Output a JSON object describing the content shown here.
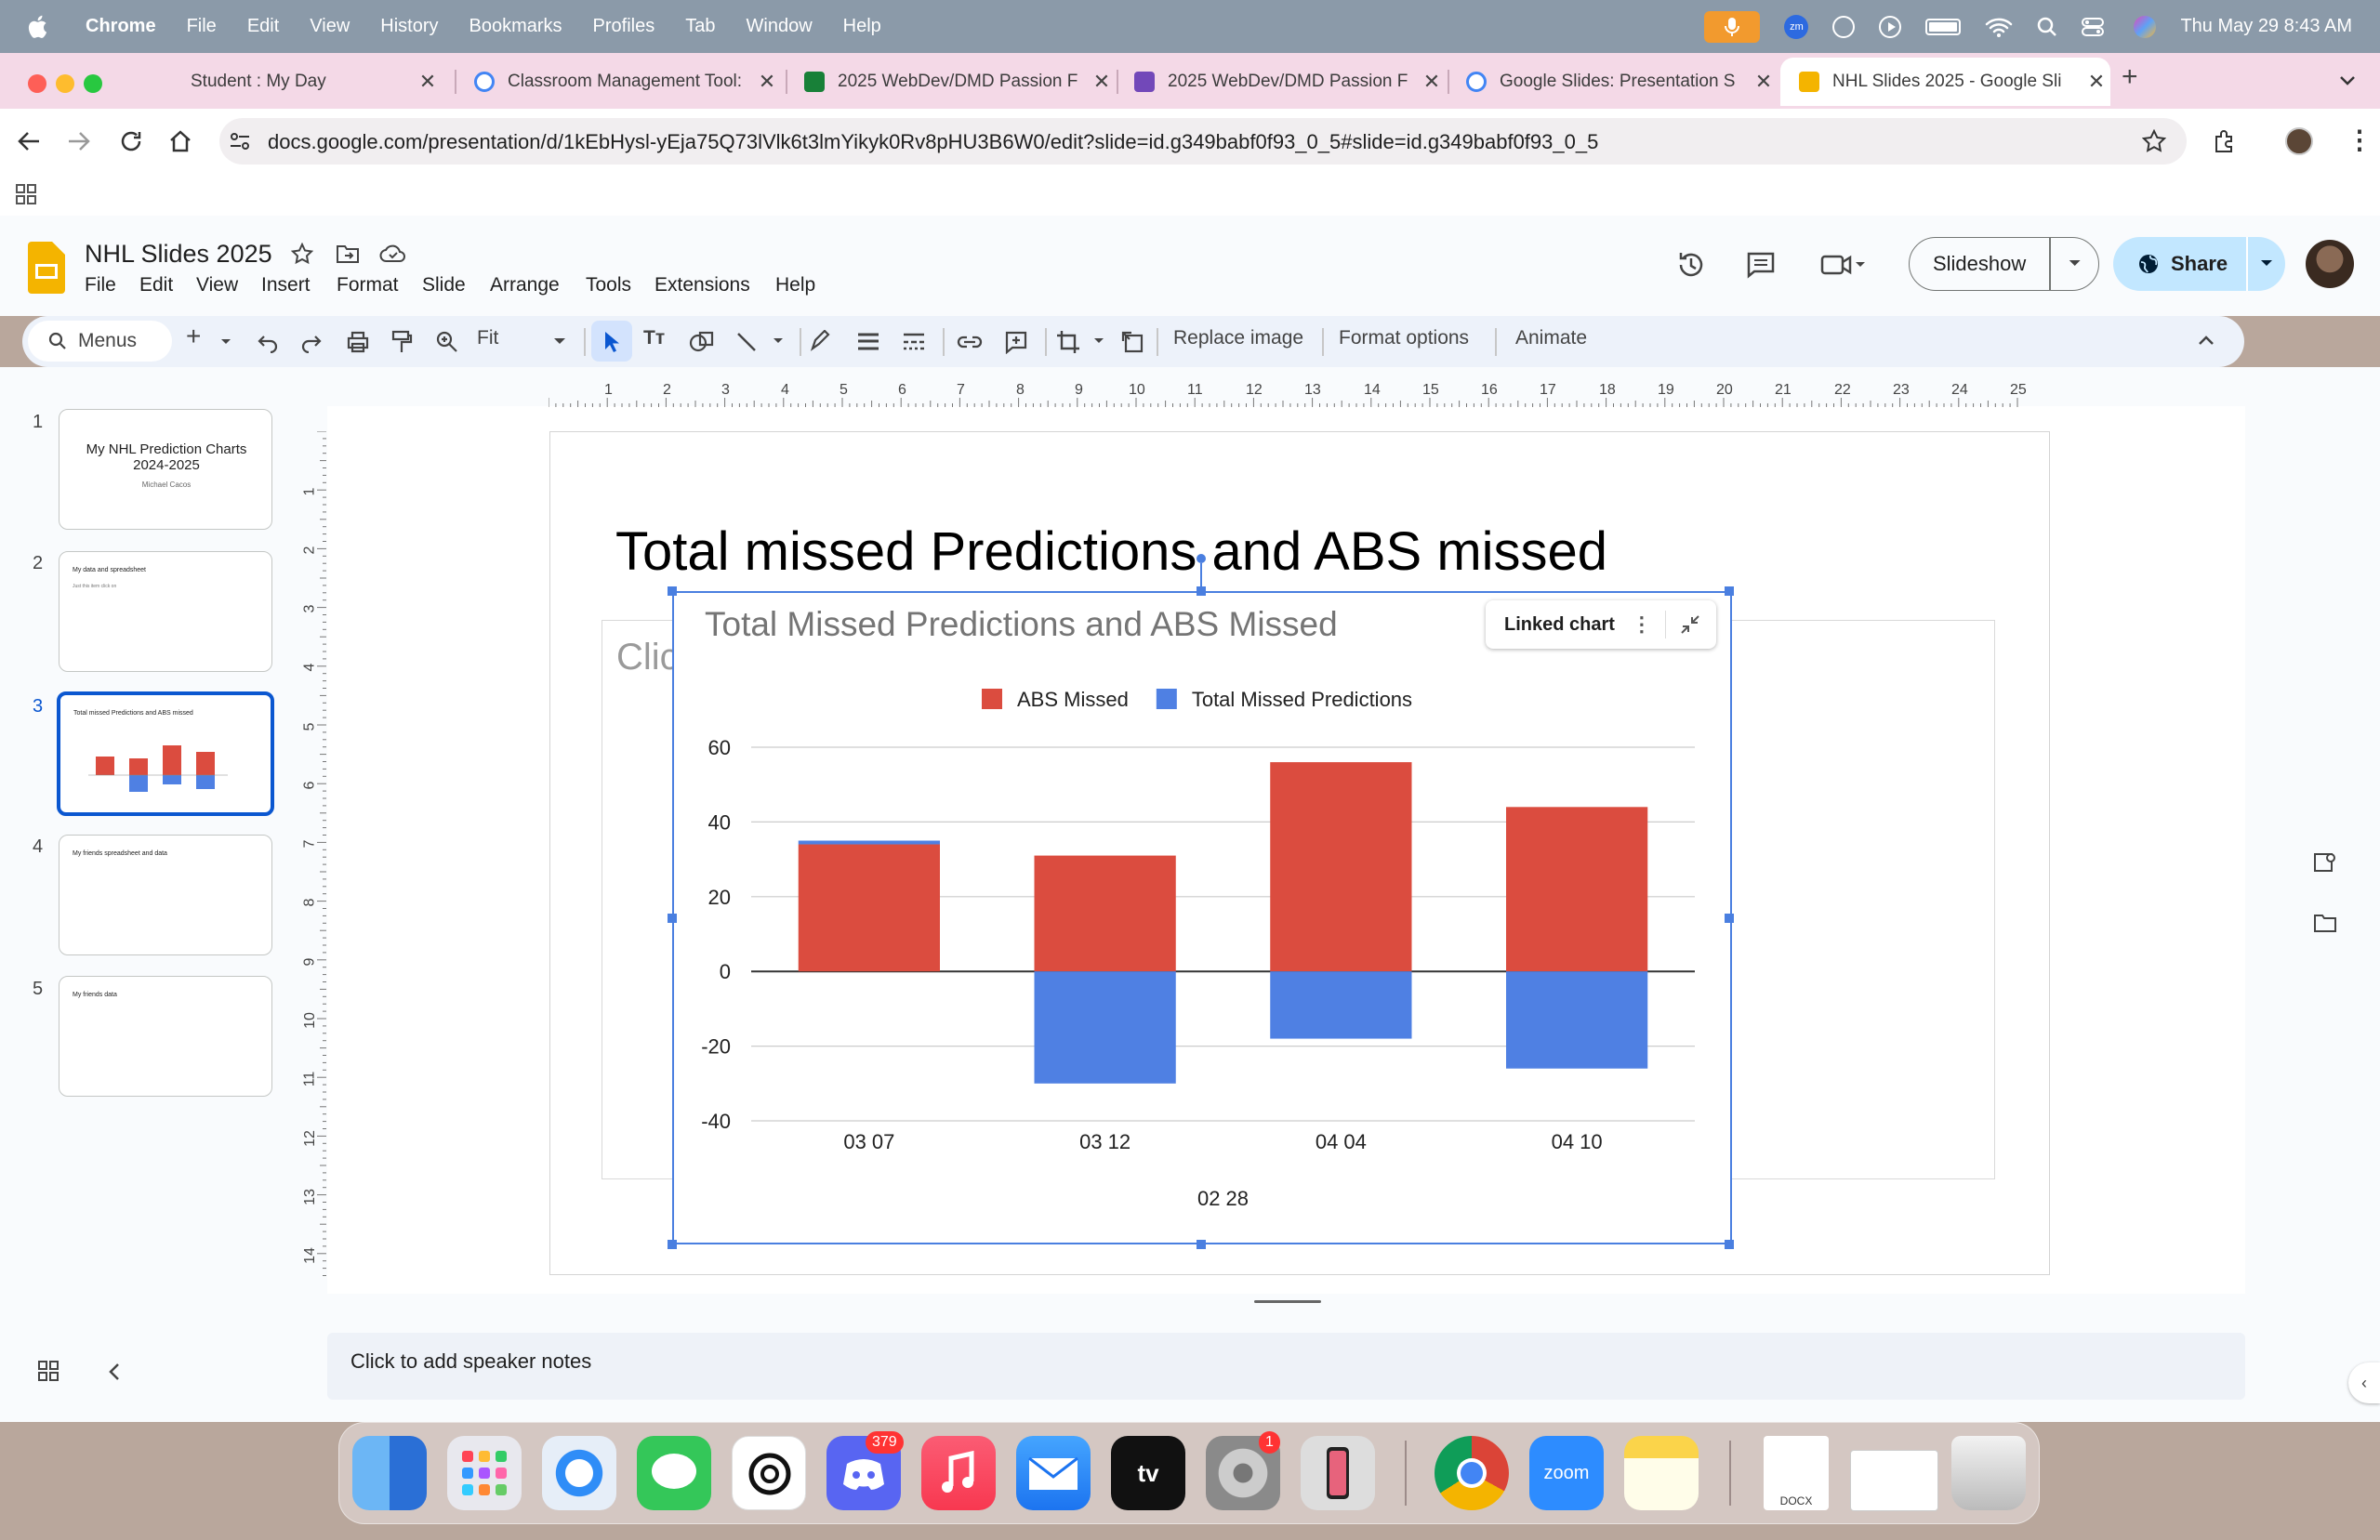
{
  "menubar": {
    "app": "Chrome",
    "items": [
      "File",
      "Edit",
      "View",
      "History",
      "Bookmarks",
      "Profiles",
      "Tab",
      "Window",
      "Help"
    ],
    "clock": "Thu May 29  8:43 AM",
    "zoom_badge": "zm"
  },
  "tabs": [
    {
      "title": "Student : My Day",
      "color": "#f4d9e7"
    },
    {
      "title": "Classroom Management Tool:",
      "color": "#4285f4"
    },
    {
      "title": "2025 WebDev/DMD Passion F",
      "color": "#188038"
    },
    {
      "title": "2025 WebDev/DMD Passion F",
      "color": "#7248b9"
    },
    {
      "title": "Google Slides: Presentation S",
      "color": "#4285f4"
    },
    {
      "title": "NHL Slides 2025 - Google Sli",
      "color": "#f4b400"
    }
  ],
  "omnibox": {
    "url": "docs.google.com/presentation/d/1kEbHysl-yEja75Q73lVlk6t3lmYikyk0Rv8pHU3B6W0/edit?slide=id.g349babf0f93_0_5#slide=id.g349babf0f93_0_5"
  },
  "doc": {
    "title": "NHL Slides 2025",
    "menus": [
      "File",
      "Edit",
      "View",
      "Insert",
      "Format",
      "Slide",
      "Arrange",
      "Tools",
      "Extensions",
      "Help"
    ],
    "slideshow": "Slideshow",
    "share": "Share"
  },
  "toolbar": {
    "search": "Menus",
    "zoom": "Fit",
    "replace_image": "Replace image",
    "format_options": "Format options",
    "animate": "Animate"
  },
  "ruler_h": [
    "1",
    "2",
    "3",
    "4",
    "5",
    "6",
    "7",
    "8",
    "9",
    "10",
    "11",
    "12",
    "13",
    "14",
    "15",
    "16",
    "17",
    "18",
    "19",
    "20",
    "21",
    "22",
    "23",
    "24",
    "25"
  ],
  "ruler_v": [
    "1",
    "2",
    "3",
    "4",
    "5",
    "6",
    "7",
    "8",
    "9",
    "10",
    "11",
    "12",
    "13",
    "14"
  ],
  "filmstrip": [
    {
      "num": "1",
      "title": "My NHL Prediction Charts 2024-2025",
      "subtitle": "Michael Cacos"
    },
    {
      "num": "2",
      "title": "My data and spreadsheet",
      "subtitle": "Just this item click on"
    },
    {
      "num": "3",
      "title": "Total missed Predictions and ABS missed",
      "subtitle": ""
    },
    {
      "num": "4",
      "title": "My friends spreadsheet and data",
      "subtitle": ""
    },
    {
      "num": "5",
      "title": "My friends data",
      "subtitle": ""
    }
  ],
  "slide": {
    "title": "Total missed Predictions and ABS missed",
    "placeholder_text": "Clic",
    "linked_chart_label": "Linked chart"
  },
  "chart_data": {
    "type": "bar",
    "title": "Total Missed Predictions and ABS Missed",
    "xlabel": "02 28",
    "ylabel": "",
    "categories": [
      "03 07",
      "03 12",
      "04 04",
      "04 10"
    ],
    "series": [
      {
        "name": "ABS Missed",
        "values": [
          34,
          31,
          56,
          44
        ],
        "color": "#db4c3f"
      },
      {
        "name": "Total Missed Predictions",
        "values": [
          1,
          -30,
          -18,
          -26
        ],
        "color": "#4f80e3"
      }
    ],
    "ylim": [
      -40,
      60
    ],
    "yticks": [
      "60",
      "40",
      "20",
      "0",
      "-20",
      "-40"
    ],
    "ytick_values": [
      60,
      40,
      20,
      0,
      -20,
      -40
    ],
    "stacked": true,
    "legend_position": "top",
    "grid": true
  },
  "notes": {
    "placeholder": "Click to add speaker notes"
  },
  "dock": {
    "discord_badge": "379",
    "settings_badge": "1",
    "zoom_label": "zoom",
    "docx_label": "DOCX"
  }
}
